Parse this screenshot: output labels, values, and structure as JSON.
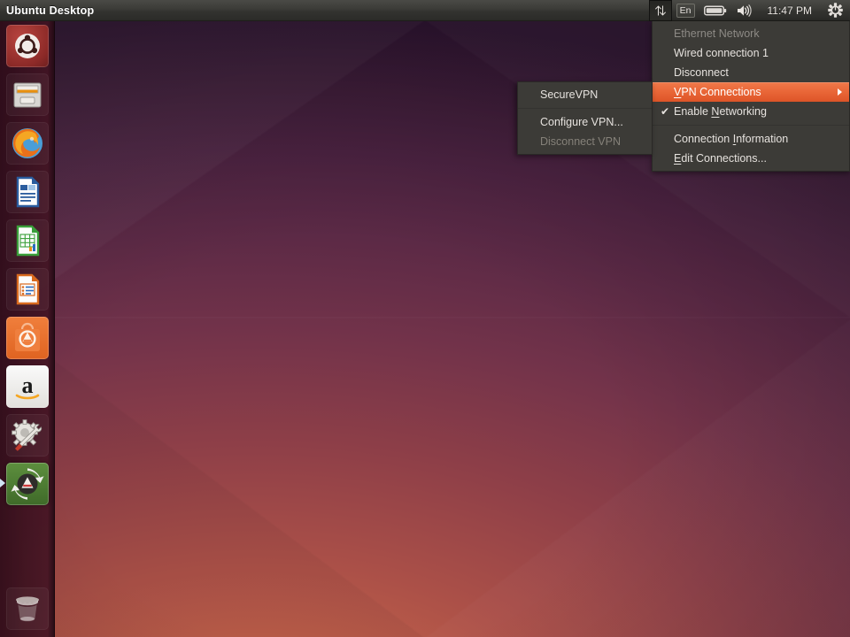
{
  "panel": {
    "title": "Ubuntu Desktop",
    "indicators": [
      {
        "name": "network-indicator",
        "icon": "network-updown-arrows-icon",
        "active": true
      },
      {
        "name": "keyboard-indicator",
        "icon": "keyboard-layout-icon",
        "label": "En",
        "active": false
      },
      {
        "name": "battery-indicator",
        "icon": "battery-icon",
        "active": false
      },
      {
        "name": "sound-indicator",
        "icon": "volume-speaker-icon",
        "active": false
      }
    ],
    "clock": "11:47 PM",
    "session_icon": "gear-power-icon"
  },
  "launcher": {
    "items": [
      {
        "name": "launcher-item-dash",
        "label": "Ubuntu Dash",
        "icon": "ubuntu-logo-icon",
        "running": false
      },
      {
        "name": "launcher-item-files",
        "label": "Files",
        "icon": "file-cabinet-icon",
        "running": false
      },
      {
        "name": "launcher-item-firefox",
        "label": "Firefox Web Browser",
        "icon": "firefox-icon",
        "running": false
      },
      {
        "name": "launcher-item-writer",
        "label": "LibreOffice Writer",
        "icon": "libreoffice-writer-icon",
        "running": false
      },
      {
        "name": "launcher-item-calc",
        "label": "LibreOffice Calc",
        "icon": "libreoffice-calc-icon",
        "running": false
      },
      {
        "name": "launcher-item-impress",
        "label": "LibreOffice Impress",
        "icon": "libreoffice-impress-icon",
        "running": false
      },
      {
        "name": "launcher-item-software-center",
        "label": "Ubuntu Software Center",
        "icon": "software-center-bag-icon",
        "running": false
      },
      {
        "name": "launcher-item-amazon",
        "label": "Amazon",
        "icon": "amazon-icon",
        "running": false
      },
      {
        "name": "launcher-item-system-settings",
        "label": "System Settings",
        "icon": "gear-wrench-icon",
        "running": false
      },
      {
        "name": "launcher-item-software-updater",
        "label": "Software Updater",
        "icon": "software-updater-icon",
        "running": true
      }
    ],
    "trash": {
      "name": "launcher-item-trash",
      "label": "Trash",
      "icon": "trash-bin-icon"
    }
  },
  "network_menu": {
    "items": [
      {
        "id": "ethernet-network-header",
        "label": "Ethernet Network",
        "type": "header",
        "state": "disabled"
      },
      {
        "id": "wired-connection-1",
        "label": "Wired connection 1",
        "type": "item",
        "state": "normal"
      },
      {
        "id": "disconnect",
        "label": "Disconnect",
        "type": "item",
        "state": "normal"
      },
      {
        "id": "vpn-connections",
        "label": "VPN Connections",
        "type": "submenu",
        "state": "highlighted",
        "mnemonic": "V"
      },
      {
        "id": "enable-networking",
        "label": "Enable Networking",
        "type": "checkbox",
        "state": "checked",
        "mnemonic": "N",
        "check_glyph": "✔"
      },
      {
        "id": "connection-information",
        "label": "Connection Information",
        "type": "item",
        "state": "normal",
        "mnemonic": "I"
      },
      {
        "id": "edit-connections",
        "label": "Edit Connections...",
        "type": "item",
        "state": "normal",
        "mnemonic": "E"
      }
    ]
  },
  "vpn_submenu": {
    "items": [
      {
        "id": "securevpn",
        "label": "SecureVPN",
        "type": "item",
        "state": "normal"
      },
      {
        "id": "configure-vpn",
        "label": "Configure VPN...",
        "type": "item",
        "state": "normal"
      },
      {
        "id": "disconnect-vpn",
        "label": "Disconnect VPN",
        "type": "item",
        "state": "disabled"
      }
    ]
  },
  "colors": {
    "panel_bg": "#3b3b37",
    "menu_bg": "#3c3b37",
    "menu_text": "#e6e2de",
    "menu_disabled_text": "#858179",
    "highlight_orange": "#e96637",
    "launcher_bg": "#3a1020",
    "wallpaper_warm": "#d4714e",
    "wallpaper_dark": "#2d1430"
  }
}
